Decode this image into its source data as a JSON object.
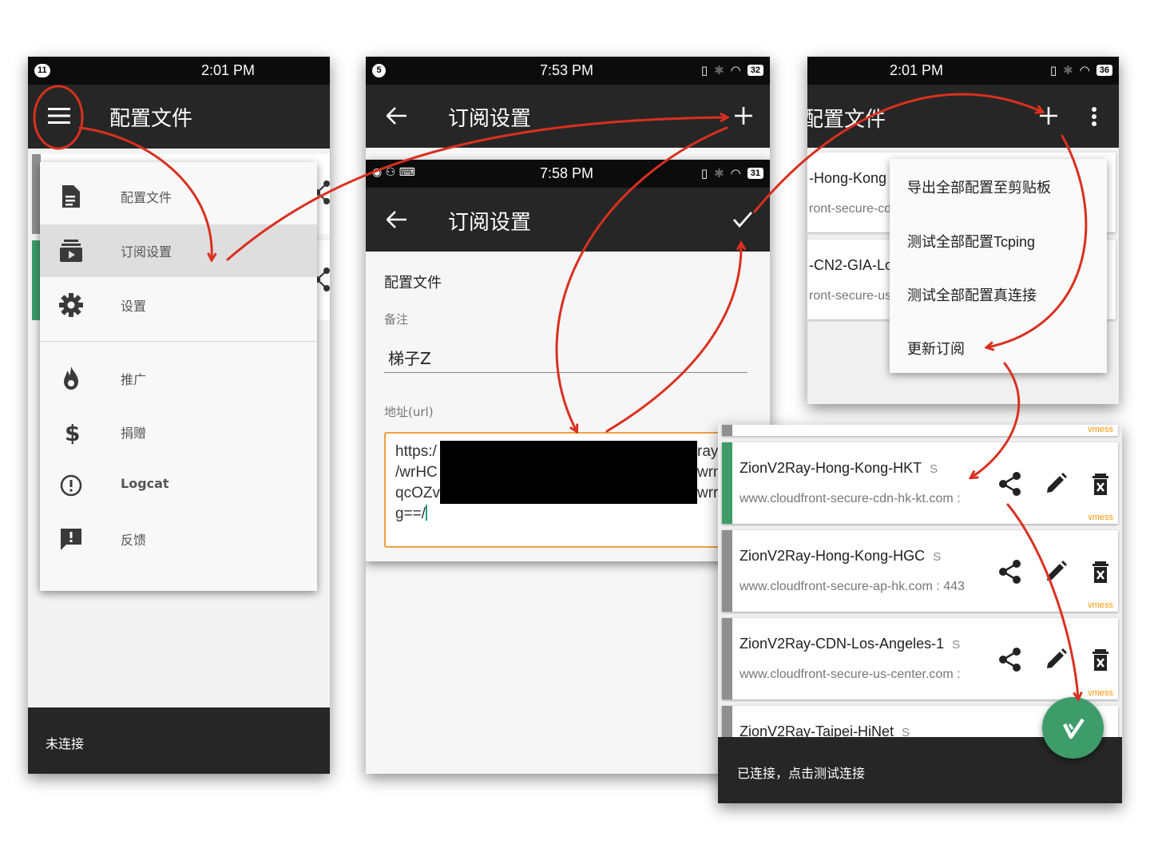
{
  "colors": {
    "appbar": "#262626",
    "statusbar": "#0c0c0c",
    "highlight": "#dedede",
    "fab": "#3d9c6a",
    "accent_orange": "#ff9800",
    "green_stripe": "#3d9c6a",
    "arrow_red": "#d93020"
  },
  "screen1": {
    "status": {
      "notif_count": "11",
      "time": "2:01 PM"
    },
    "appbar": {
      "title": "配置文件",
      "menu_icon": "hamburger-icon"
    },
    "drawer": {
      "items": [
        {
          "label": "配置文件",
          "icon": "document-icon"
        },
        {
          "label": "订阅设置",
          "icon": "subscription-icon",
          "selected": true
        },
        {
          "label": "设置",
          "icon": "gear-icon"
        },
        {
          "label": "推广",
          "icon": "fire-icon"
        },
        {
          "label": "捐赠",
          "icon": "dollar-icon"
        },
        {
          "label": "Logcat",
          "icon": "info-icon"
        },
        {
          "label": "反馈",
          "icon": "feedback-icon"
        }
      ]
    },
    "bottom": {
      "status_text": "未连接"
    }
  },
  "screen2a": {
    "status": {
      "notif_count": "5",
      "time": "7:53 PM",
      "battery": "32"
    },
    "appbar": {
      "title": "订阅设置",
      "add_icon": "plus-icon"
    }
  },
  "screen2b": {
    "status": {
      "time": "7:58 PM",
      "battery": "31"
    },
    "appbar": {
      "title": "订阅设置",
      "confirm_icon": "check-icon"
    },
    "form": {
      "section_title": "配置文件",
      "remark_label": "备注",
      "remark_value": "梯子Z",
      "url_label": "地址(url)",
      "url_lines": [
        "https:/",
        "/wrHC",
        "qcOZv",
        "g==/"
      ],
      "url_right_lines": [
        "ray",
        "wrn",
        "wrr"
      ]
    }
  },
  "screen3": {
    "status": {
      "time": "2:01 PM",
      "battery": "36"
    },
    "appbar": {
      "title": "配置文件",
      "add_icon": "plus-icon",
      "more_icon": "more-vert-icon"
    },
    "behind_cards": [
      {
        "name": "-Hong-Kong",
        "addr": "ront-secure-cd"
      },
      {
        "name": "-CN2-GIA-Lo",
        "addr": "ront-secure-us"
      }
    ],
    "popup_menu": [
      "导出全部配置至剪贴板",
      "测试全部配置Tcping",
      "测试全部配置真连接",
      "更新订阅"
    ]
  },
  "screen4": {
    "cards": [
      {
        "name": "ZionV2Ray-Hong-Kong-HKT",
        "status": "S",
        "addr": "www.cloudfront-secure-cdn-hk-kt.com :",
        "type": "vmess",
        "active": true
      },
      {
        "name": "ZionV2Ray-Hong-Kong-HGC",
        "status": "S",
        "addr": "www.cloudfront-secure-ap-hk.com : 443",
        "type": "vmess",
        "active": false
      },
      {
        "name": "ZionV2Ray-CDN-Los-Angeles-1",
        "status": "S",
        "addr": "www.cloudfront-secure-us-center.com :",
        "type": "vmess",
        "active": false
      },
      {
        "name": "ZionV2Ray-Taipei-HiNet",
        "status": "S",
        "addr": "",
        "type": "",
        "active": false
      }
    ],
    "top_type": "vmess",
    "bottom": {
      "status_text": "已连接，点击测试连接"
    },
    "fab_icon": "v-logo-icon"
  }
}
